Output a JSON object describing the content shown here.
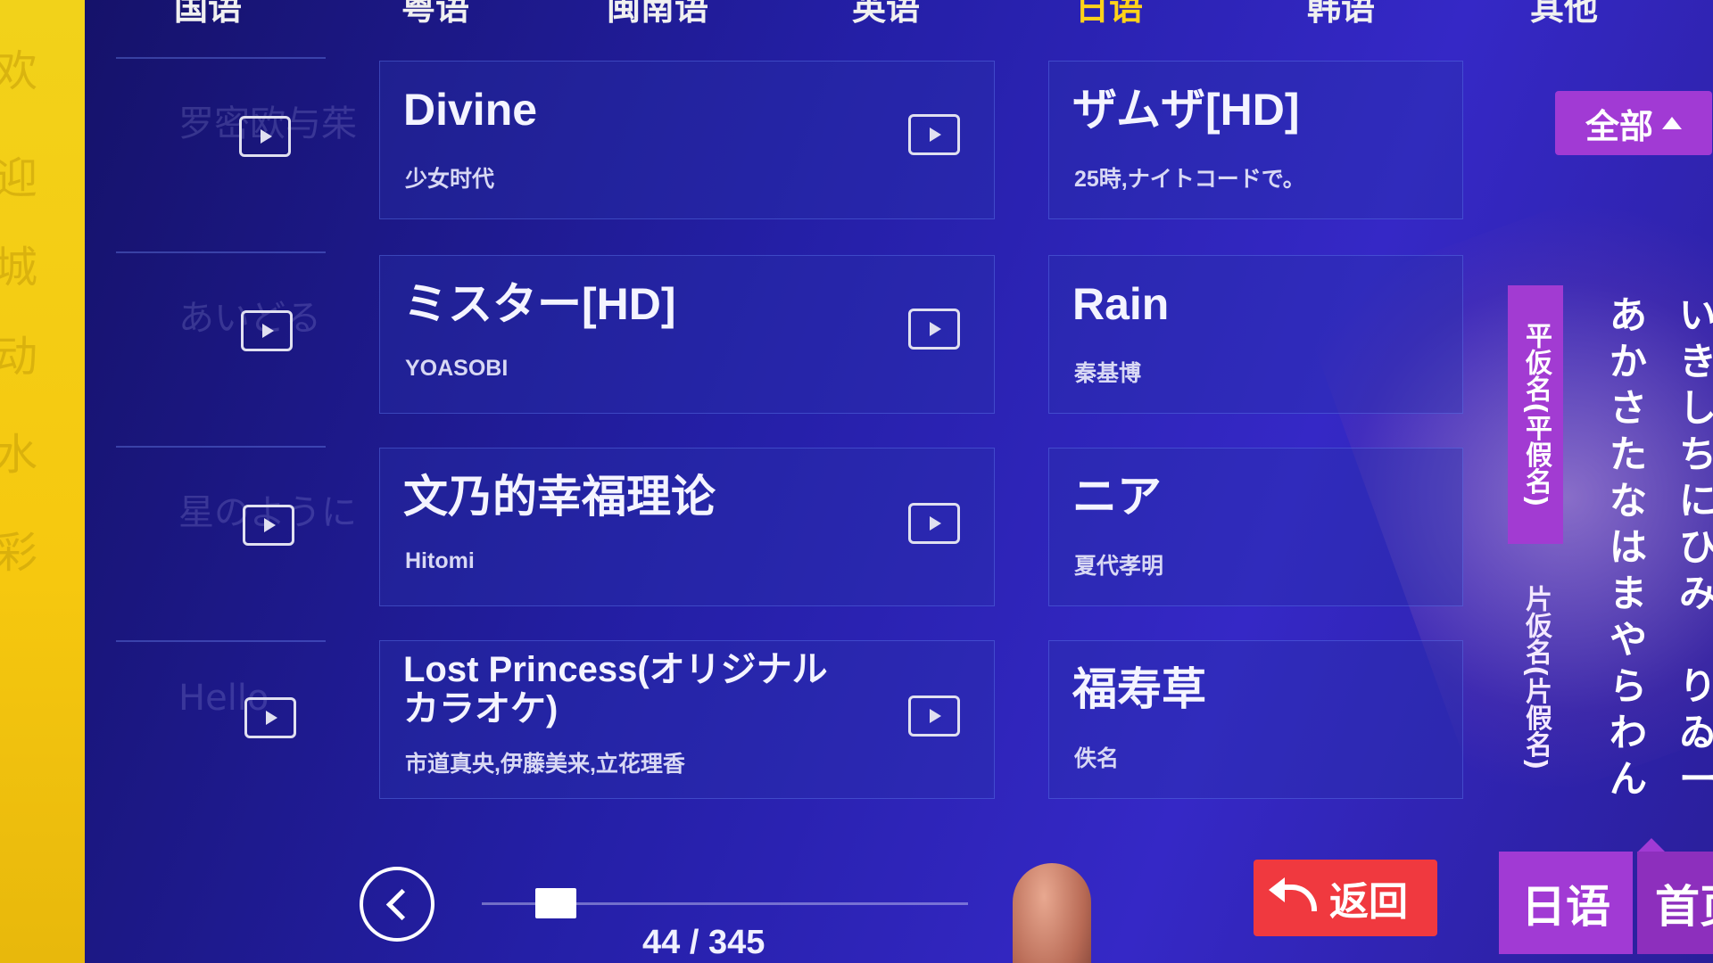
{
  "tabs": [
    {
      "label": "国语",
      "active": false
    },
    {
      "label": "粤语",
      "active": false
    },
    {
      "label": "闽南语",
      "active": false
    },
    {
      "label": "英语",
      "active": false
    },
    {
      "label": "日语",
      "active": true
    },
    {
      "label": "韩语",
      "active": false
    },
    {
      "label": "其他",
      "active": false
    }
  ],
  "left_column_ghosts": [
    "罗密欧与茱",
    "あいどる",
    "星のように",
    "Hello"
  ],
  "songs": [
    {
      "title": "Divine",
      "artist": "少女时代"
    },
    {
      "title": "ザムザ[HD]",
      "artist": "25時,ナイトコードで。"
    },
    {
      "title": "ミスター[HD]",
      "artist": "YOASOBI"
    },
    {
      "title": "Rain",
      "artist": "秦基博"
    },
    {
      "title": "文乃的幸福理论",
      "artist": "Hitomi"
    },
    {
      "title": "ニア",
      "artist": "夏代孝明"
    },
    {
      "title": "Lost Princess(オリジナル カラオケ)",
      "artist": "市道真央,伊藤美来,立花理香"
    },
    {
      "title": "福寿草",
      "artist": "佚名"
    }
  ],
  "filter": {
    "all_label": "全部"
  },
  "kana_panel": {
    "hiragana_label": "平仮名(平假名)",
    "katakana_label": "片仮名(片假名)",
    "column1": [
      "あ",
      "か",
      "さ",
      "た",
      "な",
      "は",
      "ま",
      "や",
      "ら",
      "わ",
      "ん"
    ],
    "column2": [
      "い",
      "き",
      "し",
      "ち",
      "に",
      "ひ",
      "み",
      "",
      "り",
      "ゐ",
      "ー"
    ]
  },
  "pagination": {
    "current": 44,
    "total": 345,
    "text": "44 / 345"
  },
  "bottom": {
    "back_label": "返回",
    "lang_label": "日语",
    "first_label": "首页"
  },
  "colors": {
    "accent_purple": "#a13ad4",
    "back_red": "#f0393f",
    "active_tab": "#ffd21a"
  }
}
